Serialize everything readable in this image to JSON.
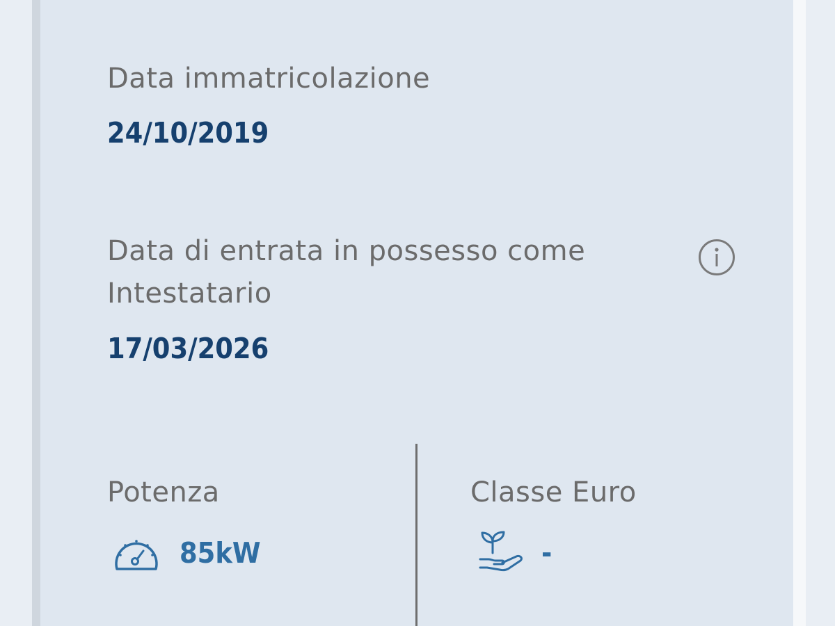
{
  "registration": {
    "label": "Data immatricolazione",
    "value": "24/10/2019"
  },
  "ownership": {
    "label_line1": "Data di entrata in possesso come",
    "label_line2": "Intestatario",
    "value": "17/03/2026",
    "info_icon": "info-circle-icon"
  },
  "power": {
    "label": "Potenza",
    "value": "85kW",
    "icon": "speedometer-icon"
  },
  "euro_class": {
    "label": "Classe Euro",
    "value": "-",
    "icon": "plant-in-hand-icon"
  },
  "colors": {
    "card_background": "#dfe7f0",
    "label_text": "#6b6b6b",
    "value_text": "#16406e",
    "accent_blue": "#2f6ea3"
  }
}
